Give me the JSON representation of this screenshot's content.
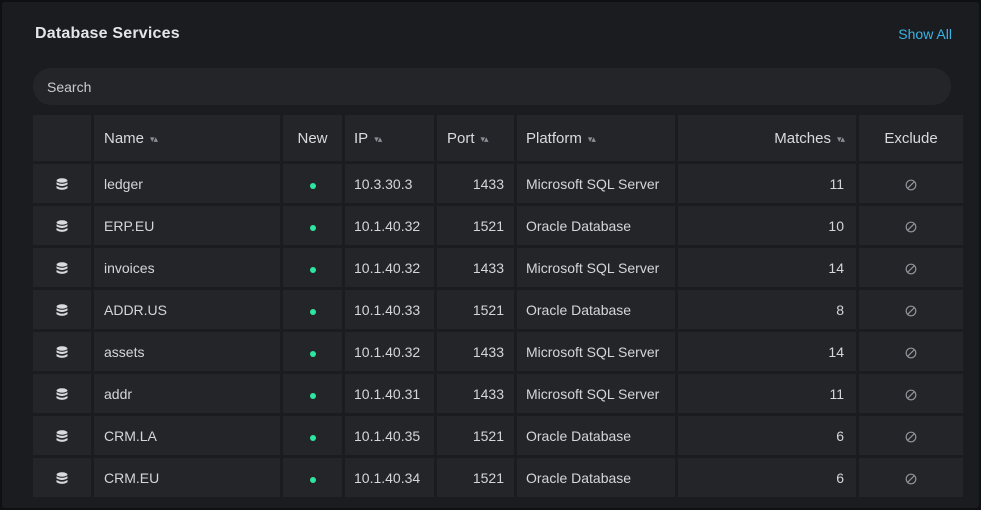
{
  "header": {
    "title": "Database Services",
    "show_all_label": "Show All"
  },
  "search": {
    "placeholder": "Search",
    "value": ""
  },
  "table": {
    "columns": {
      "name": "Name",
      "new": "New",
      "ip": "IP",
      "port": "Port",
      "platform": "Platform",
      "matches": "Matches",
      "exclude": "Exclude"
    },
    "sortable_columns": [
      "Name",
      "IP",
      "Port",
      "Platform",
      "Matches"
    ],
    "rows": [
      {
        "icon": "database-icon",
        "name": "ledger",
        "new": true,
        "ip": "10.3.30.3",
        "port": "1433",
        "platform": "Microsoft SQL Server",
        "matches": "11",
        "exclude_icon": "exclude-icon"
      },
      {
        "icon": "database-icon",
        "name": "ERP.EU",
        "new": true,
        "ip": "10.1.40.32",
        "port": "1521",
        "platform": "Oracle Database",
        "matches": "10",
        "exclude_icon": "exclude-icon"
      },
      {
        "icon": "database-icon",
        "name": "invoices",
        "new": true,
        "ip": "10.1.40.32",
        "port": "1433",
        "platform": "Microsoft SQL Server",
        "matches": "14",
        "exclude_icon": "exclude-icon"
      },
      {
        "icon": "database-icon",
        "name": "ADDR.US",
        "new": true,
        "ip": "10.1.40.33",
        "port": "1521",
        "platform": "Oracle Database",
        "matches": "8",
        "exclude_icon": "exclude-icon"
      },
      {
        "icon": "database-icon",
        "name": "assets",
        "new": true,
        "ip": "10.1.40.32",
        "port": "1433",
        "platform": "Microsoft SQL Server",
        "matches": "14",
        "exclude_icon": "exclude-icon"
      },
      {
        "icon": "database-icon",
        "name": "addr",
        "new": true,
        "ip": "10.1.40.31",
        "port": "1433",
        "platform": "Microsoft SQL Server",
        "matches": "11",
        "exclude_icon": "exclude-icon"
      },
      {
        "icon": "database-icon",
        "name": "CRM.LA",
        "new": true,
        "ip": "10.1.40.35",
        "port": "1521",
        "platform": "Oracle Database",
        "matches": "6",
        "exclude_icon": "exclude-icon"
      },
      {
        "icon": "database-icon",
        "name": "CRM.EU",
        "new": true,
        "ip": "10.1.40.34",
        "port": "1521",
        "platform": "Oracle Database",
        "matches": "6",
        "exclude_icon": "exclude-icon"
      }
    ]
  },
  "colors": {
    "accent": "#3ab2e6",
    "new_indicator": "#2ee6a0",
    "panel_bg": "#1a1c1f",
    "cell_bg": "#232528"
  }
}
